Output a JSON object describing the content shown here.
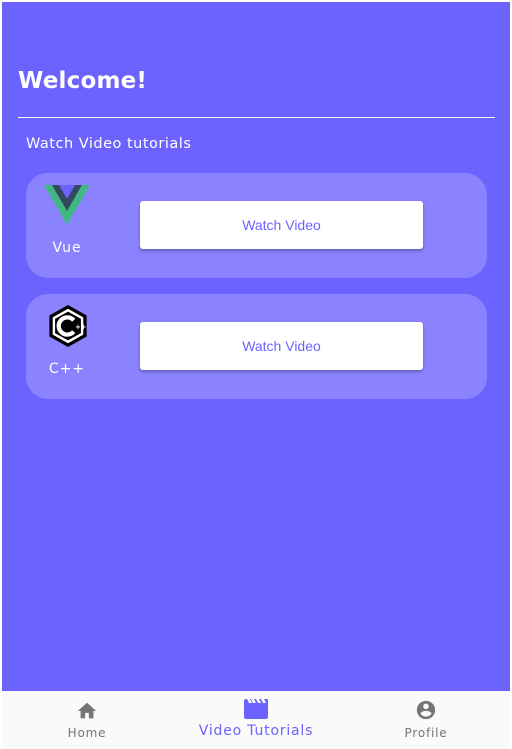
{
  "header": {
    "title": "Welcome!",
    "subtitle": "Watch Video tutorials"
  },
  "cards": [
    {
      "label": "Vue",
      "icon": "vue-logo-icon",
      "button_label": "Watch Video"
    },
    {
      "label": "C++",
      "icon": "cpp-logo-icon",
      "button_label": "Watch Video"
    }
  ],
  "bottom_nav": {
    "items": [
      {
        "label": "Home",
        "icon": "home-icon",
        "active": false
      },
      {
        "label": "Video Tutorials",
        "icon": "video-clapperboard-icon",
        "active": true
      },
      {
        "label": "Profile",
        "icon": "account-circle-icon",
        "active": false
      }
    ]
  },
  "colors": {
    "background": "#6c63fe",
    "card": "#8a82ff",
    "accent": "#6c63fe",
    "nav_background": "#fafafa",
    "nav_inactive": "#757575",
    "vue_green": "#41b883",
    "vue_dark": "#34495e"
  }
}
